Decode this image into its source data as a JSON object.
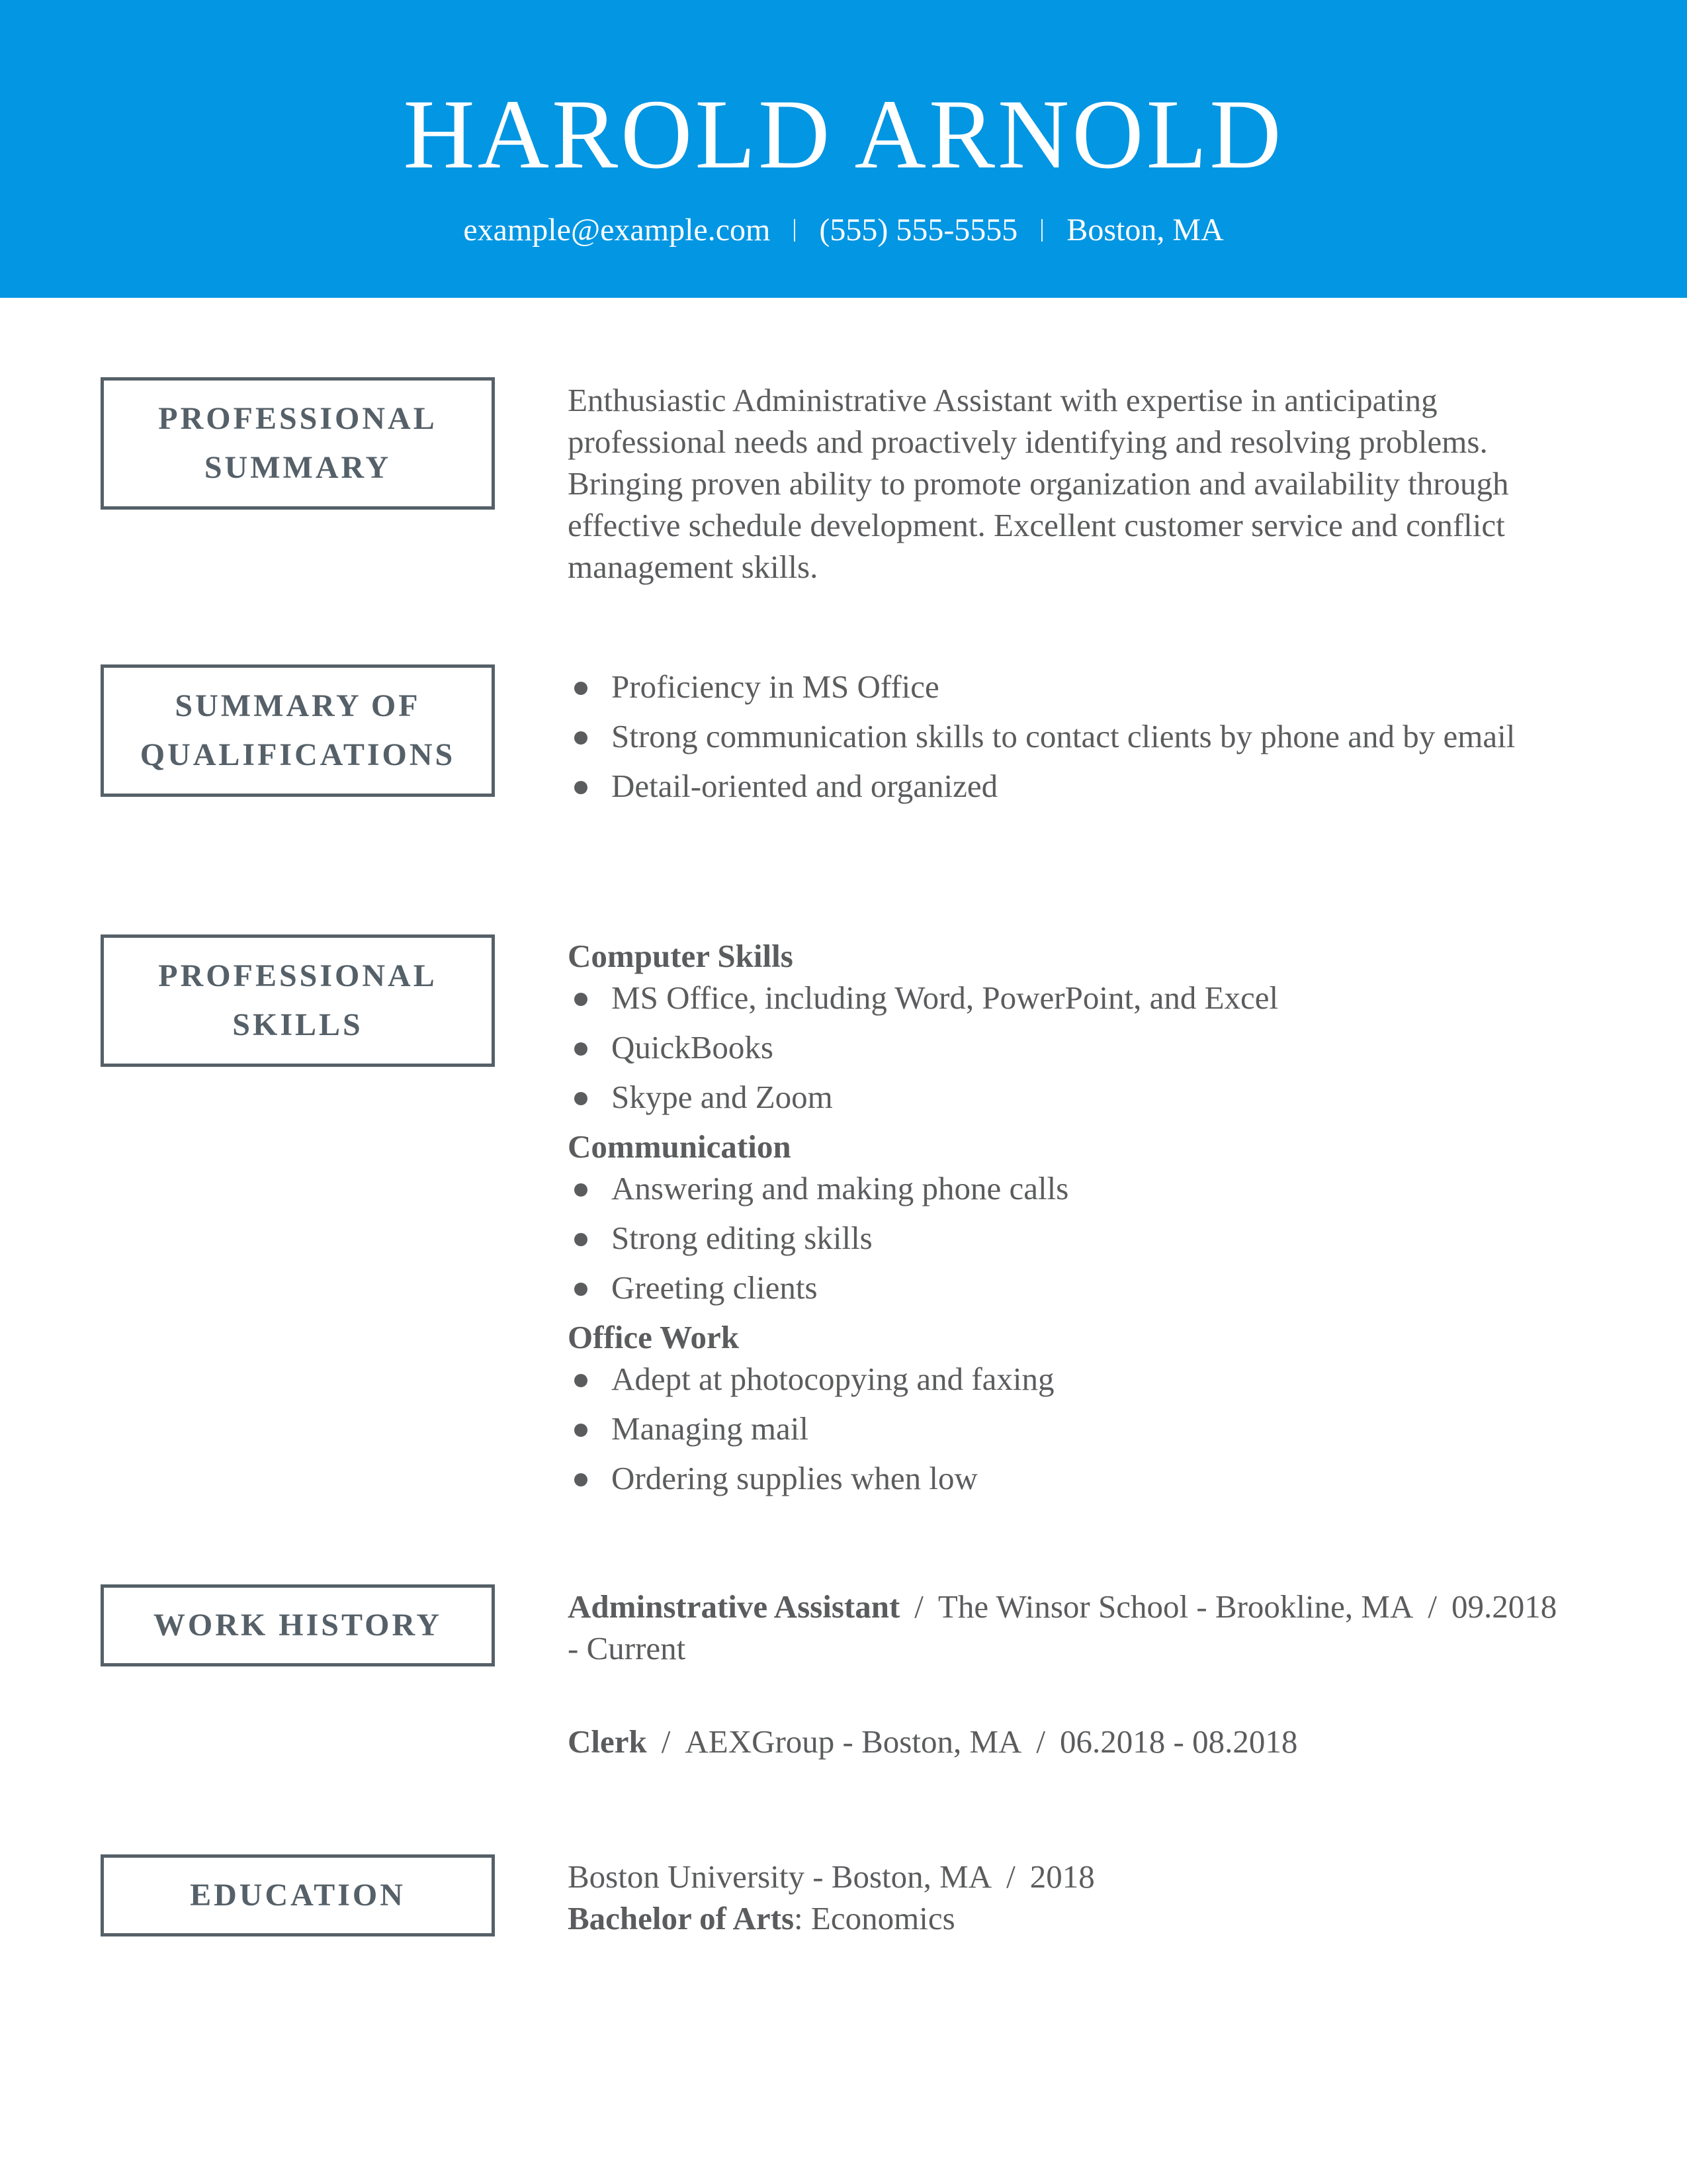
{
  "header": {
    "name": "HAROLD ARNOLD",
    "email": "example@example.com",
    "phone": "(555) 555-5555",
    "location": "Boston, MA",
    "brand_color": "#0296e3"
  },
  "sections": {
    "summary": {
      "label_line1": "PROFESSIONAL",
      "label_line2": "SUMMARY",
      "text": "Enthusiastic Administrative Assistant with expertise in anticipating professional needs and proactively identifying and resolving problems. Bringing proven ability to promote organization and availability through effective schedule development. Excellent customer service and conflict management skills."
    },
    "qualifications": {
      "label_line1": "SUMMARY OF",
      "label_line2": "QUALIFICATIONS",
      "items": [
        "Proficiency in MS Office",
        "Strong communication skills to contact clients by phone and by email",
        "Detail-oriented and organized"
      ]
    },
    "skills": {
      "label_line1": "PROFESSIONAL",
      "label_line2": "SKILLS",
      "groups": [
        {
          "title": "Computer Skills",
          "items": [
            "MS Office, including Word, PowerPoint, and Excel",
            "QuickBooks",
            "Skype and Zoom"
          ]
        },
        {
          "title": "Communication",
          "items": [
            "Answering and making phone calls",
            "Strong editing skills",
            "Greeting clients"
          ]
        },
        {
          "title": "Office Work",
          "items": [
            "Adept at photocopying and faxing",
            "Managing mail",
            "Ordering supplies when low"
          ]
        }
      ]
    },
    "work": {
      "label": "WORK HISTORY",
      "jobs": [
        {
          "title": "Adminstrative Assistant",
          "employer": "The Winsor School - Brookline, MA",
          "dates": "09.2018 - Current"
        },
        {
          "title": "Clerk",
          "employer": "AEXGroup - Boston, MA",
          "dates": "06.2018 - 08.2018"
        }
      ]
    },
    "education": {
      "label": "EDUCATION",
      "school": "Boston University - Boston, MA",
      "year": "2018",
      "degree": "Bachelor of Arts",
      "field": "Economics"
    }
  },
  "separators": {
    "slash": "/",
    "colon": ":"
  }
}
